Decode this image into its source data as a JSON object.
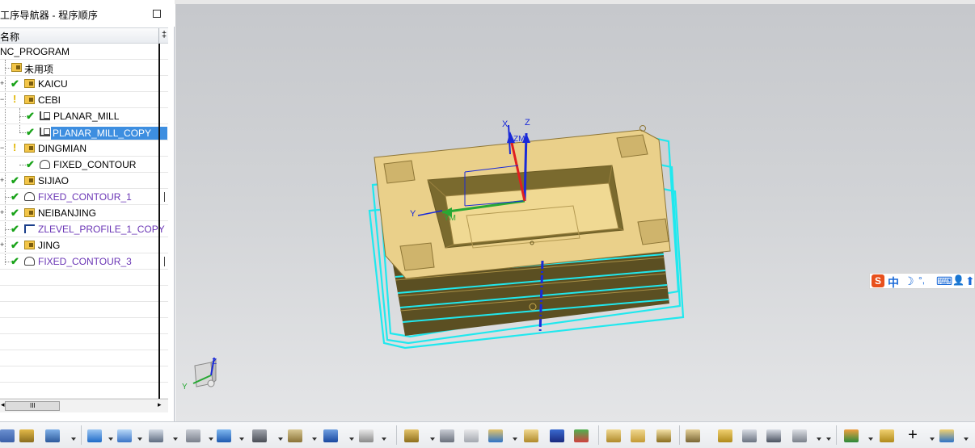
{
  "navigator": {
    "title": "工序导航器 - 程序顺序",
    "column_name": "名称",
    "root": "NC_PROGRAM",
    "items": [
      {
        "label": "未用项",
        "status": "none",
        "icon": "folder-icon",
        "indent": 1
      },
      {
        "label": "KAICU",
        "status": "ok",
        "icon": "folder-icon",
        "indent": 1,
        "expand": "+"
      },
      {
        "label": "CEBI",
        "status": "warn",
        "icon": "folder-icon",
        "indent": 1,
        "expand": "-"
      },
      {
        "label": "PLANAR_MILL",
        "status": "ok",
        "icon": "planar-mill-icon",
        "indent": 2
      },
      {
        "label": "PLANAR_MILL_COPY",
        "status": "ok",
        "icon": "planar-mill-icon",
        "indent": 2,
        "selected": true
      },
      {
        "label": "DINGMIAN",
        "status": "warn",
        "icon": "folder-icon",
        "indent": 1,
        "expand": "-"
      },
      {
        "label": "FIXED_CONTOUR",
        "status": "ok",
        "icon": "fixed-contour-icon",
        "indent": 2
      },
      {
        "label": "SIJIAO",
        "status": "ok",
        "icon": "folder-icon",
        "indent": 1,
        "expand": "+"
      },
      {
        "label": "FIXED_CONTOUR_1",
        "status": "ok",
        "icon": "fixed-contour-icon",
        "indent": 1,
        "purple": true
      },
      {
        "label": "NEIBANJING",
        "status": "ok",
        "icon": "folder-icon",
        "indent": 1,
        "expand": "+"
      },
      {
        "label": "ZLEVEL_PROFILE_1_COPY",
        "status": "ok",
        "icon": "zlevel-profile-icon",
        "indent": 1,
        "purple": true
      },
      {
        "label": "JING",
        "status": "ok",
        "icon": "folder-icon",
        "indent": 1,
        "expand": "+"
      },
      {
        "label": "FIXED_CONTOUR_3",
        "status": "ok",
        "icon": "fixed-contour-icon",
        "indent": 1,
        "purple": true
      }
    ],
    "scroll_grip": "III"
  },
  "view": {
    "csys_labels": {
      "x": "X",
      "z": "Z",
      "y": "Y",
      "ym": "YM",
      "zm": "ZM"
    },
    "triad": {
      "z": "Z",
      "y": "Y"
    },
    "colors": {
      "part_top": "#ead08a",
      "part_side": "#7a6a2e",
      "blank_outline": "#20e8ee",
      "axis_blue": "#1a2ad8",
      "axis_green": "#28a834",
      "axis_red": "#e02020"
    }
  },
  "ime": {
    "logo": "S",
    "lang": "中",
    "moon": "☽",
    "punct": "°,",
    "keyboard": "⌨",
    "user": "👤",
    "arrow": "⬆"
  },
  "toolbar": {
    "icons": [
      "create-program-icon",
      "create-tool-icon",
      "create-geometry-icon",
      "create-method-icon",
      "create-operation-icon",
      "generate-toolpath-icon",
      "replay-toolpath-icon",
      "verify-toolpath-icon",
      "list-toolpath-icon",
      "postprocess-icon",
      "shop-docs-icon",
      "text-annotation-icon",
      "inspect-icon",
      "wcs-origin-icon",
      "view-orient-icon",
      "layer-icon",
      "part-navigator-icon",
      "snap-point-icon",
      "selection-filter-icon",
      "show-hide-icon",
      "move-object-icon",
      "render-style-icon",
      "edit-object-icon",
      "section-view-icon",
      "chain-link-icon",
      "measure-icon",
      "analysis-icon",
      "feature-icon",
      "material-icon",
      "link-icon",
      "crosshair-icon",
      "insert-icon"
    ]
  }
}
